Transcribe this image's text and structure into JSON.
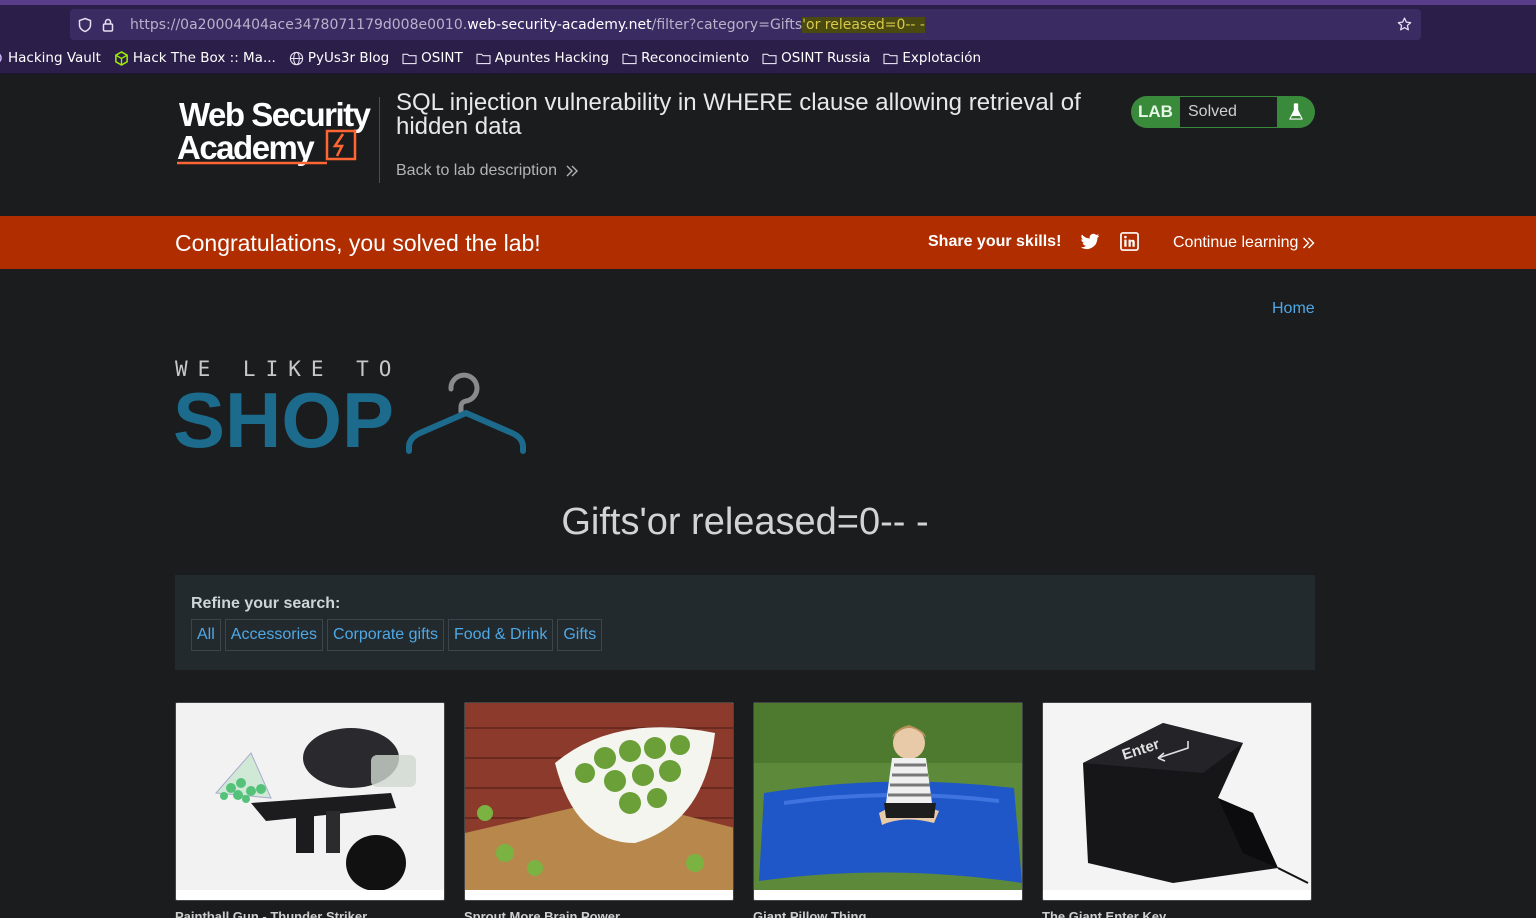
{
  "browser": {
    "url_scheme_prefix": "https://0a20004404ace3478071179d008e0010.",
    "url_host": "web-security-academy.net",
    "url_path": "/filter?category=Gifts",
    "url_injection": "'or released=0-- -",
    "bookmarks": [
      {
        "label": "Hacking Vault",
        "icon": "partial-icon"
      },
      {
        "label": "Hack The Box :: Ma...",
        "icon": "htb-cube-icon"
      },
      {
        "label": "PyUs3r Blog",
        "icon": "globe-icon"
      },
      {
        "label": "OSINT",
        "icon": "folder-icon"
      },
      {
        "label": "Apuntes Hacking",
        "icon": "folder-icon"
      },
      {
        "label": "Reconocimiento",
        "icon": "folder-icon"
      },
      {
        "label": "OSINT Russia",
        "icon": "folder-icon"
      },
      {
        "label": "Explotación",
        "icon": "folder-icon"
      }
    ]
  },
  "academy": {
    "logo_line1": "Web Security",
    "logo_line2": "Academy",
    "lab_title": "SQL injection vulnerability in WHERE clause allowing retrieval of hidden data",
    "back_link": "Back to lab description",
    "badge_lab": "LAB",
    "badge_status": "Solved"
  },
  "banner": {
    "message": "Congratulations, you solved the lab!",
    "share": "Share your skills!",
    "continue": "Continue learning"
  },
  "shop": {
    "home_link": "Home",
    "logo_top": "WE LIKE TO",
    "logo_main": "SHOP",
    "heading": "Gifts'or released=0-- -",
    "refine_label": "Refine your search:",
    "filters": [
      "All",
      "Accessories",
      "Corporate gifts",
      "Food & Drink",
      "Gifts"
    ],
    "products": [
      {
        "title": "Paintball Gun - Thunder Striker"
      },
      {
        "title": "Sprout More Brain Power"
      },
      {
        "title": "Giant Pillow Thing"
      },
      {
        "title": "The Giant Enter Key"
      }
    ],
    "enter_key_label": "Enter"
  },
  "colors": {
    "banner": "#b02d00",
    "link": "#4fa8e6",
    "lab_green": "#3a8a3c",
    "shop_logo": "#1c6b8c"
  }
}
